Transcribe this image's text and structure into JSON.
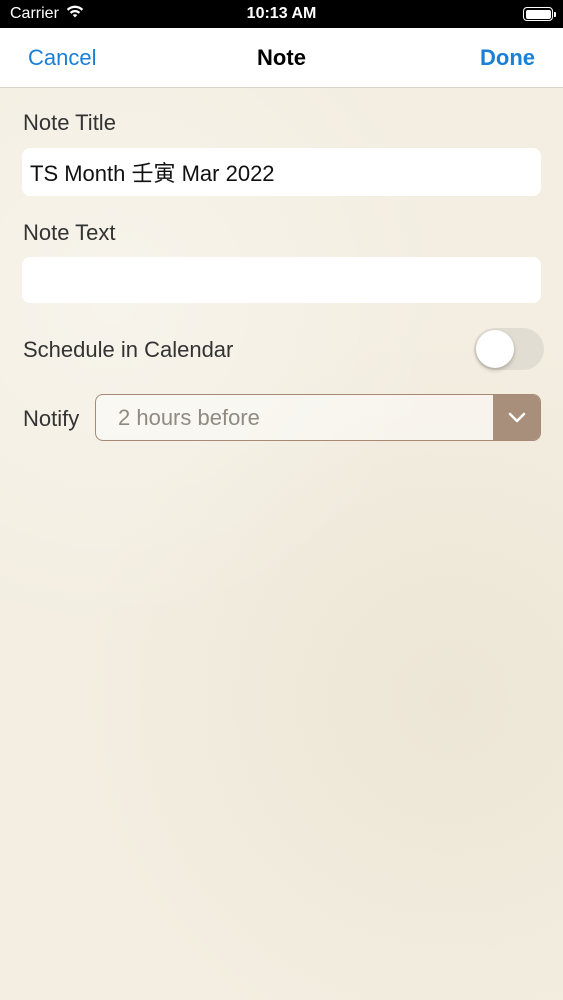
{
  "status_bar": {
    "carrier": "Carrier",
    "time": "10:13 AM"
  },
  "nav": {
    "cancel_label": "Cancel",
    "title": "Note",
    "done_label": "Done"
  },
  "form": {
    "note_title_label": "Note Title",
    "note_title_value": "TS Month 壬寅 Mar 2022",
    "note_text_label": "Note Text",
    "note_text_value": "",
    "schedule_label": "Schedule in Calendar",
    "schedule_enabled": false,
    "notify_label": "Notify",
    "notify_value": "2 hours before"
  },
  "icons": {
    "wifi": "wifi-icon",
    "battery": "battery-icon",
    "dropdown": "chevron-down-icon"
  },
  "colors": {
    "accent": "#1a7fd6",
    "background": "#f3eee1",
    "select_border": "#a68a76",
    "select_arrow_bg": "#a88f7b"
  }
}
